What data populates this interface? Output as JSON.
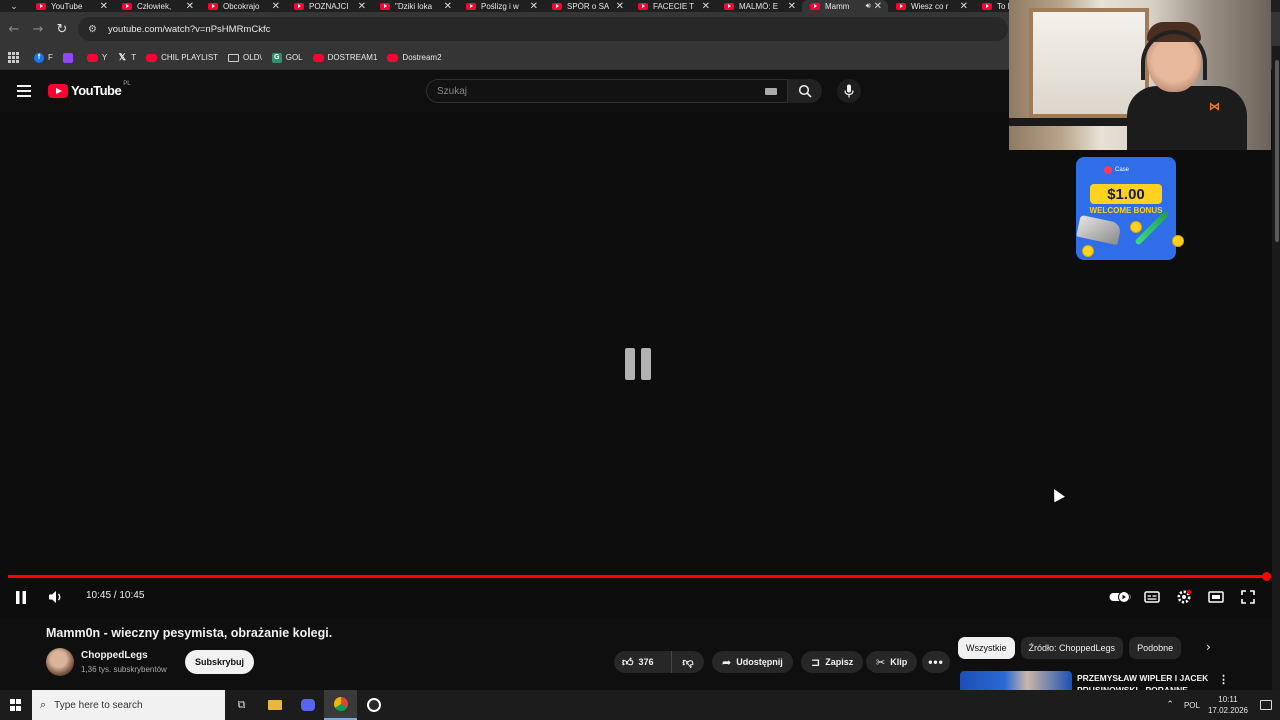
{
  "browser": {
    "tabs": [
      {
        "title": "YouTube",
        "active": false
      },
      {
        "title": "Człowiek,",
        "active": false
      },
      {
        "title": "Obcokrajo",
        "active": false
      },
      {
        "title": "POZNAJCI",
        "active": false
      },
      {
        "title": "\"Dziki loka",
        "active": false
      },
      {
        "title": "Poślizg i w",
        "active": false
      },
      {
        "title": "SPÓR o SA",
        "active": false
      },
      {
        "title": "FACECIE T",
        "active": false
      },
      {
        "title": "MALMÖ: E",
        "active": false
      },
      {
        "title": "Mamm",
        "active": true
      },
      {
        "title": "Wiesz co r",
        "active": false
      },
      {
        "title": "To Ni",
        "active": false
      }
    ],
    "close_glyph": "✕",
    "url": "youtube.com/watch?v=nPsHMRmCkfc",
    "bookmarks": [
      {
        "label": "F",
        "icon": "facebook-icon"
      },
      {
        "label": "",
        "icon": "twitch-icon"
      },
      {
        "label": "Y",
        "icon": "youtube-icon"
      },
      {
        "label": "T",
        "icon": "x-icon"
      },
      {
        "label": "CHIL PLAYLIST",
        "icon": "youtube-icon"
      },
      {
        "label": "OLD\\",
        "icon": "folder-icon"
      },
      {
        "label": "GOL",
        "icon": "gol-icon"
      },
      {
        "label": "DOSTREAM1",
        "icon": "youtube-icon"
      },
      {
        "label": "Dostream2",
        "icon": "youtube-icon"
      }
    ]
  },
  "youtube": {
    "logo_text": "YouTube",
    "country_code": "PL",
    "search_placeholder": "Szukaj"
  },
  "player": {
    "state": "paused",
    "time_display": "10:45 / 10:45",
    "progress": 1.0,
    "accent_color": "#ff0000"
  },
  "video": {
    "title": "Mamm0n - wieczny pesymista, obrażanie kolegi.",
    "channel": "ChoppedLegs",
    "subscribers": "1,36 tys. subskrybentów",
    "subscribe_label": "Subskrybuj",
    "likes": "376",
    "share_label": "Udostępnij",
    "save_label": "Zapisz",
    "clip_label": "Klip"
  },
  "related": {
    "chips": [
      "Wszystkie",
      "Źródło: ChoppedLegs",
      "Podobne"
    ],
    "first_title": "PRZEMYSŁAW WIPLER I JACEK PRUSINOWSKI - PORANNE"
  },
  "ad": {
    "brand": "Case",
    "amount": "$1.00",
    "bonus": "WELCOME BONUS"
  },
  "taskbar": {
    "search_placeholder": "Type here to search",
    "language": "POL",
    "time": "10:11",
    "date": "17.02.2026"
  }
}
